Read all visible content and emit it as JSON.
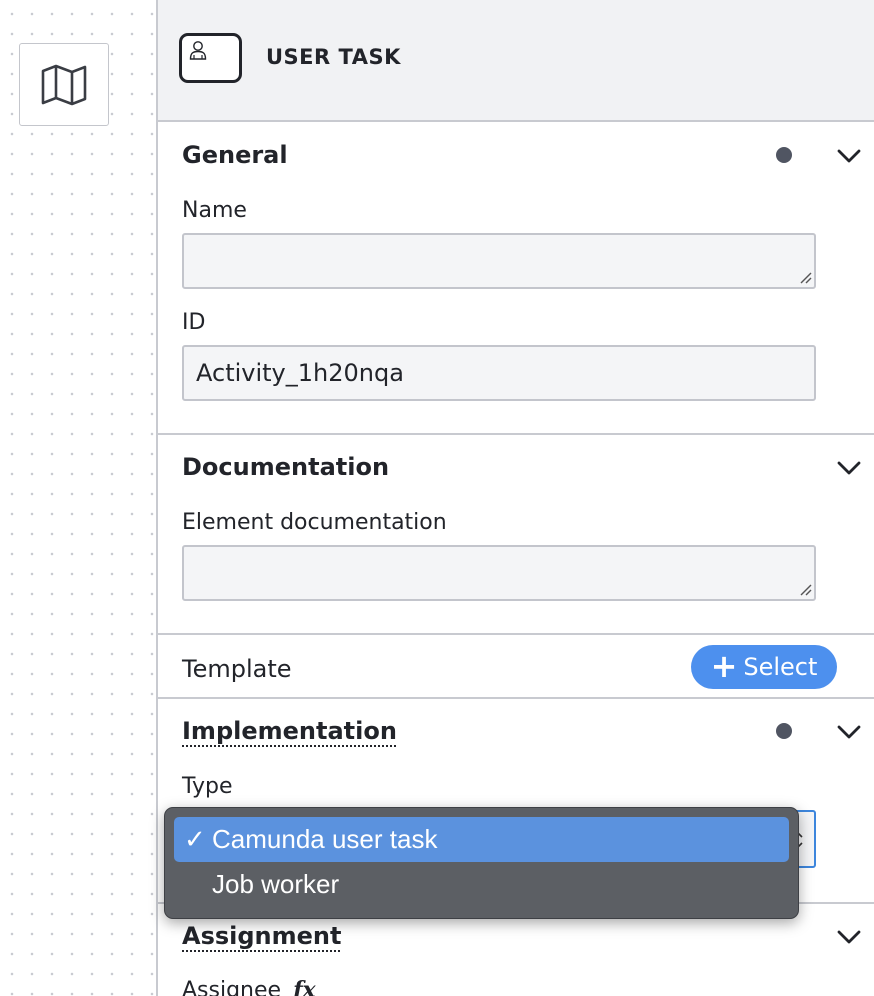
{
  "header": {
    "title": "USER TASK",
    "element_icon": "user-task-icon"
  },
  "canvas": {
    "map_toggle_icon": "map-icon"
  },
  "general": {
    "title": "General",
    "name_label": "Name",
    "name_value": "",
    "id_label": "ID",
    "id_value": "Activity_1h20nqa"
  },
  "documentation": {
    "title": "Documentation",
    "element_documentation_label": "Element documentation",
    "element_documentation_value": ""
  },
  "template": {
    "label": "Template",
    "select_label": "Select",
    "select_icon": "plus-icon"
  },
  "implementation": {
    "title": "Implementation",
    "type_label": "Type",
    "type_value": "Camunda user task",
    "options": [
      {
        "label": "Camunda user task",
        "selected": true
      },
      {
        "label": "Job worker",
        "selected": false
      }
    ],
    "check_glyph": "✓"
  },
  "assignment": {
    "title": "Assignment",
    "assignee_label": "Assignee",
    "fx_label": "fx"
  },
  "colors": {
    "accent": "#4d90ee",
    "dropdown_bg": "#5c5f64",
    "dropdown_selected": "#5b92de",
    "indicator": "#505562"
  }
}
